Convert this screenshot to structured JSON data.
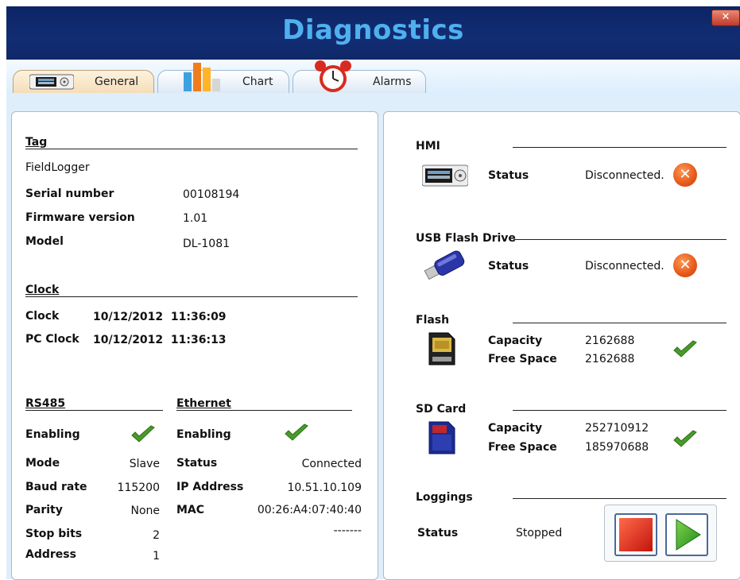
{
  "window": {
    "title": "Diagnostics",
    "close_glyph": "✕"
  },
  "tabs": [
    {
      "label": "General",
      "icon": "hmi-device-icon",
      "active": true
    },
    {
      "label": "Chart",
      "icon": "bar-chart-icon",
      "active": false
    },
    {
      "label": "Alarms",
      "icon": "alarm-clock-icon",
      "active": false
    }
  ],
  "left": {
    "tag": {
      "heading": "Tag",
      "name": "FieldLogger"
    },
    "info": [
      {
        "label": "Serial number",
        "value": "00108194"
      },
      {
        "label": "Firmware version",
        "value": "1.01"
      },
      {
        "label": "Model",
        "value": "DL-1081"
      }
    ],
    "clock": {
      "heading": "Clock",
      "rows": [
        {
          "label": "Clock",
          "value": "10/12/2012  11:36:09"
        },
        {
          "label": "PC Clock",
          "value": "10/12/2012  11:36:13"
        }
      ]
    },
    "rs485": {
      "heading": "RS485",
      "enabling_label": "Enabling",
      "rows": [
        {
          "label": "Mode",
          "value": "Slave"
        },
        {
          "label": "Baud rate",
          "value": "115200"
        },
        {
          "label": "Parity",
          "value": "None"
        },
        {
          "label": "Stop bits",
          "value": "2"
        },
        {
          "label": "Address",
          "value": "1"
        }
      ]
    },
    "ethernet": {
      "heading": "Ethernet",
      "enabling_label": "Enabling",
      "rows": [
        {
          "label": "Status",
          "value": "Connected"
        },
        {
          "label": "IP Address",
          "value": "10.51.10.109"
        },
        {
          "label": "MAC",
          "value": "00:26:A4:07:40:40"
        },
        {
          "label": "",
          "value": "-------"
        }
      ]
    }
  },
  "right": {
    "hmi": {
      "heading": "HMI",
      "status_label": "Status",
      "status": "Disconnected."
    },
    "usb": {
      "heading": "USB Flash Drive",
      "status_label": "Status",
      "status": "Disconnected."
    },
    "flash": {
      "heading": "Flash",
      "capacity_label": "Capacity",
      "capacity": "2162688",
      "free_label": "Free Space",
      "free": "2162688"
    },
    "sd": {
      "heading": "SD Card",
      "capacity_label": "Capacity",
      "capacity": "252710912",
      "free_label": "Free Space",
      "free": "185970688"
    },
    "loggings": {
      "heading": "Loggings",
      "status_label": "Status",
      "status": "Stopped"
    }
  },
  "colors": {
    "title_bar": "#0f2868",
    "title_text": "#4fb0ee",
    "check_green": "#4a9a2a",
    "error_orange": "#e5581a",
    "workspace": "#dfeefb"
  }
}
